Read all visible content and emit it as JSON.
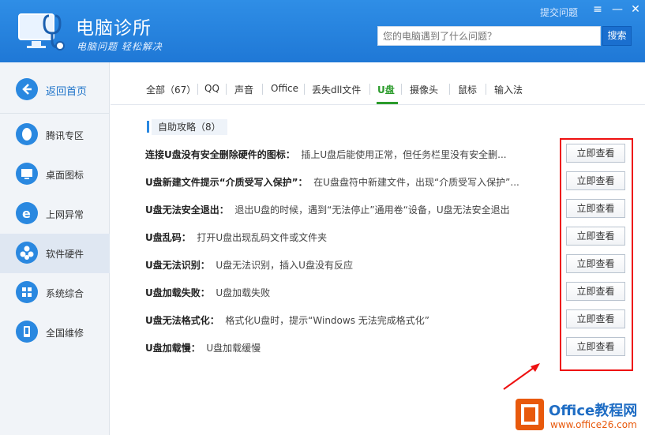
{
  "app": {
    "title": "电脑诊所",
    "slogan": "电脑问题 轻松解决",
    "report_link": "提交问题",
    "window_buttons": {
      "menu": "≡",
      "minimize": "—",
      "close": "✕"
    }
  },
  "search": {
    "placeholder": "您的电脑遇到了什么问题？",
    "button_label": "搜索"
  },
  "sidebar": {
    "back_label": "返回首页",
    "items": [
      {
        "label": "腾讯专区",
        "icon": "penguin-icon"
      },
      {
        "label": "桌面图标",
        "icon": "monitor-icon"
      },
      {
        "label": "上网异常",
        "icon": "ie-browser-icon"
      },
      {
        "label": "软件硬件",
        "icon": "software-hardware-icon",
        "active": true
      },
      {
        "label": "系统综合",
        "icon": "windows-icon"
      },
      {
        "label": "全国维修",
        "icon": "repair-phone-icon"
      }
    ]
  },
  "tabs": [
    {
      "label": "全部（67）"
    },
    {
      "label": "QQ"
    },
    {
      "label": "声音"
    },
    {
      "label": "Office"
    },
    {
      "label": "丢失dll文件"
    },
    {
      "label": "U盘",
      "active": true
    },
    {
      "label": "摄像头"
    },
    {
      "label": "鼠标"
    },
    {
      "label": "输入法"
    }
  ],
  "section": {
    "title": "自助攻略（8）"
  },
  "articles": [
    {
      "question": "连接U盘没有安全删除硬件的图标：",
      "desc": "插上U盘后能使用正常，但任务栏里没有安全删...",
      "button": "立即查看"
    },
    {
      "question": "U盘新建文件提示“介质受写入保护”：",
      "desc": "在U盘盘符中新建文件，出现“介质受写入保护”...",
      "button": "立即查看"
    },
    {
      "question": "U盘无法安全退出：",
      "desc": "退出U盘的时候，遇到“无法停止”通用卷“设备，U盘无法安全退出",
      "button": "立即查看"
    },
    {
      "question": "U盘乱码：",
      "desc": "打开U盘出现乱码文件或文件夹",
      "button": "立即查看"
    },
    {
      "question": "U盘无法识别：",
      "desc": "U盘无法识别，插入U盘没有反应",
      "button": "立即查看"
    },
    {
      "question": "U盘加载失败：",
      "desc": "U盘加载失败",
      "button": "立即查看"
    },
    {
      "question": "U盘无法格式化：",
      "desc": "格式化U盘时，提示“Windows 无法完成格式化”",
      "button": "立即查看"
    },
    {
      "question": "U盘加载慢：",
      "desc": "U盘加载缓慢",
      "button": "立即查看"
    }
  ],
  "watermark": {
    "title": "Office教程网",
    "url": "www.office26.com"
  },
  "colors": {
    "header": "#1f78d6",
    "accent": "#2a88e0",
    "active_tab": "#2b9b2b",
    "highlight": "#ee1111"
  }
}
